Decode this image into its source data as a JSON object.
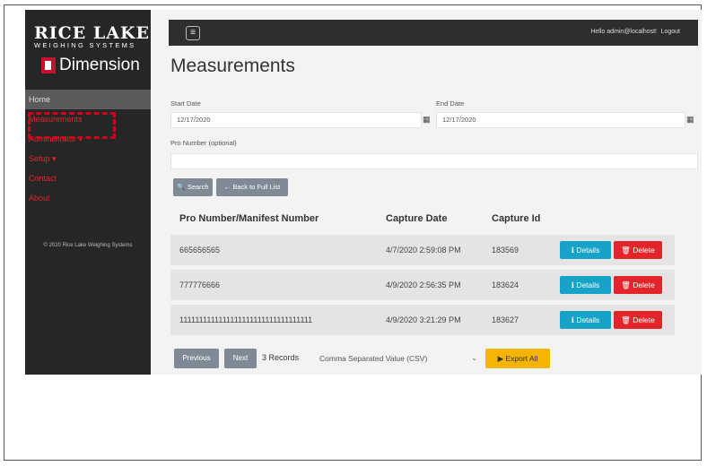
{
  "sidebar": {
    "brand": "RICE LAKE",
    "brand_sub": "WEIGHING SYSTEMS",
    "product": "Dimension",
    "nav": [
      "Home",
      "Measurements",
      "Administrator ▾",
      "Setup ▾",
      "Contact",
      "About"
    ],
    "copyright": "© 2020 Rice Lake Weighing Systems"
  },
  "topbar": {
    "menu_icon": "≡",
    "greeting": "Hello admin@localhost!",
    "logout": "Logout"
  },
  "page": {
    "title": "Measurements",
    "start_date_label": "Start Date",
    "start_date_value": "12/17/2020",
    "end_date_label": "End Date",
    "end_date_value": "12/17/2020",
    "pro_label": "Pro Number (optional)",
    "pro_value": "",
    "search_label": "Search",
    "back_label": "← Back to Full List"
  },
  "table": {
    "headers": [
      "Pro Number/Manifest Number",
      "Capture Date",
      "Capture Id"
    ],
    "rows": [
      {
        "pro": "665656565",
        "date": "4/7/2020 2:59:08 PM",
        "id": "183569"
      },
      {
        "pro": "777776666",
        "date": "4/9/2020 2:56:35 PM",
        "id": "183624"
      },
      {
        "pro": "1111111111111111111111111111111111",
        "date": "4/9/2020 3:21:29 PM",
        "id": "183627"
      }
    ],
    "details_label": "Details",
    "delete_label": "Delete"
  },
  "footer": {
    "previous": "Previous",
    "next": "Next",
    "records": "3 Records",
    "format": "Comma Separated Value (CSV)",
    "export": "Export All"
  },
  "colors": {
    "accent_red": "#e3242b",
    "details_blue": "#17a2c8",
    "export_yellow": "#f4b400",
    "sidebar_bg": "#262626"
  }
}
